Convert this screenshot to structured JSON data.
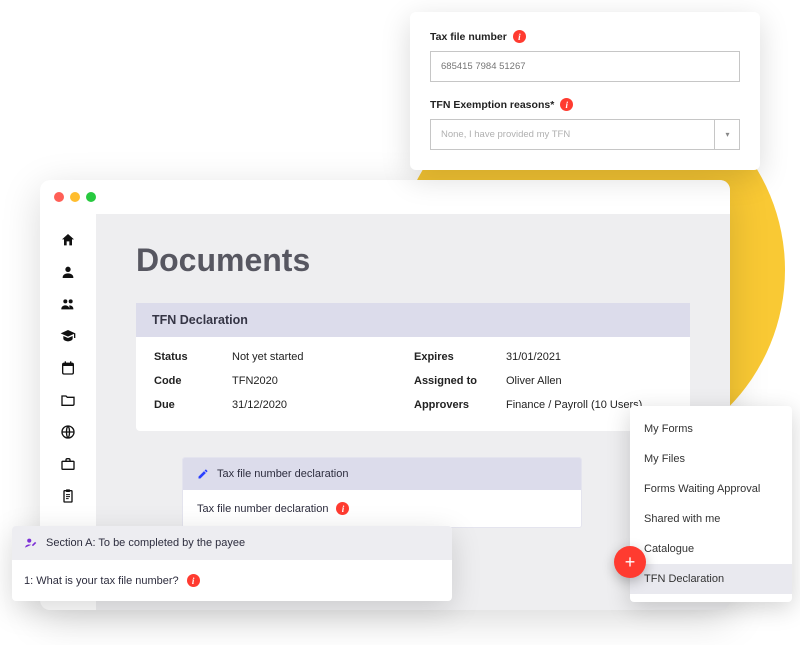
{
  "page_title": "Documents",
  "floating_form": {
    "tfn_label": "Tax file number",
    "tfn_placeholder": "685415 7984 51267",
    "exemption_label": "TFN Exemption reasons*",
    "exemption_value": "None, I have provided my TFN"
  },
  "declaration_card": {
    "title": "TFN Declaration",
    "left": {
      "status_label": "Status",
      "status_value": "Not yet started",
      "code_label": "Code",
      "code_value": "TFN2020",
      "due_label": "Due",
      "due_value": "31/12/2020"
    },
    "right": {
      "expires_label": "Expires",
      "expires_value": "31/01/2021",
      "assigned_label": "Assigned to",
      "assigned_value": "Oliver Allen",
      "approvers_label": "Approvers",
      "approvers_value": "Finance / Payroll (10 Users)"
    }
  },
  "subcard": {
    "header": "Tax file number declaration",
    "body": "Tax file number declaration"
  },
  "section_card": {
    "header": "Section A: To be completed by the payee",
    "question": "1: What is your tax file number?"
  },
  "menu": {
    "items": [
      "My Forms",
      "My Files",
      "Forms Waiting Approval",
      "Shared with me",
      "Catalogue",
      "TFN Declaration"
    ],
    "active_index": 5
  },
  "info_glyph": "i",
  "fab_glyph": "+"
}
